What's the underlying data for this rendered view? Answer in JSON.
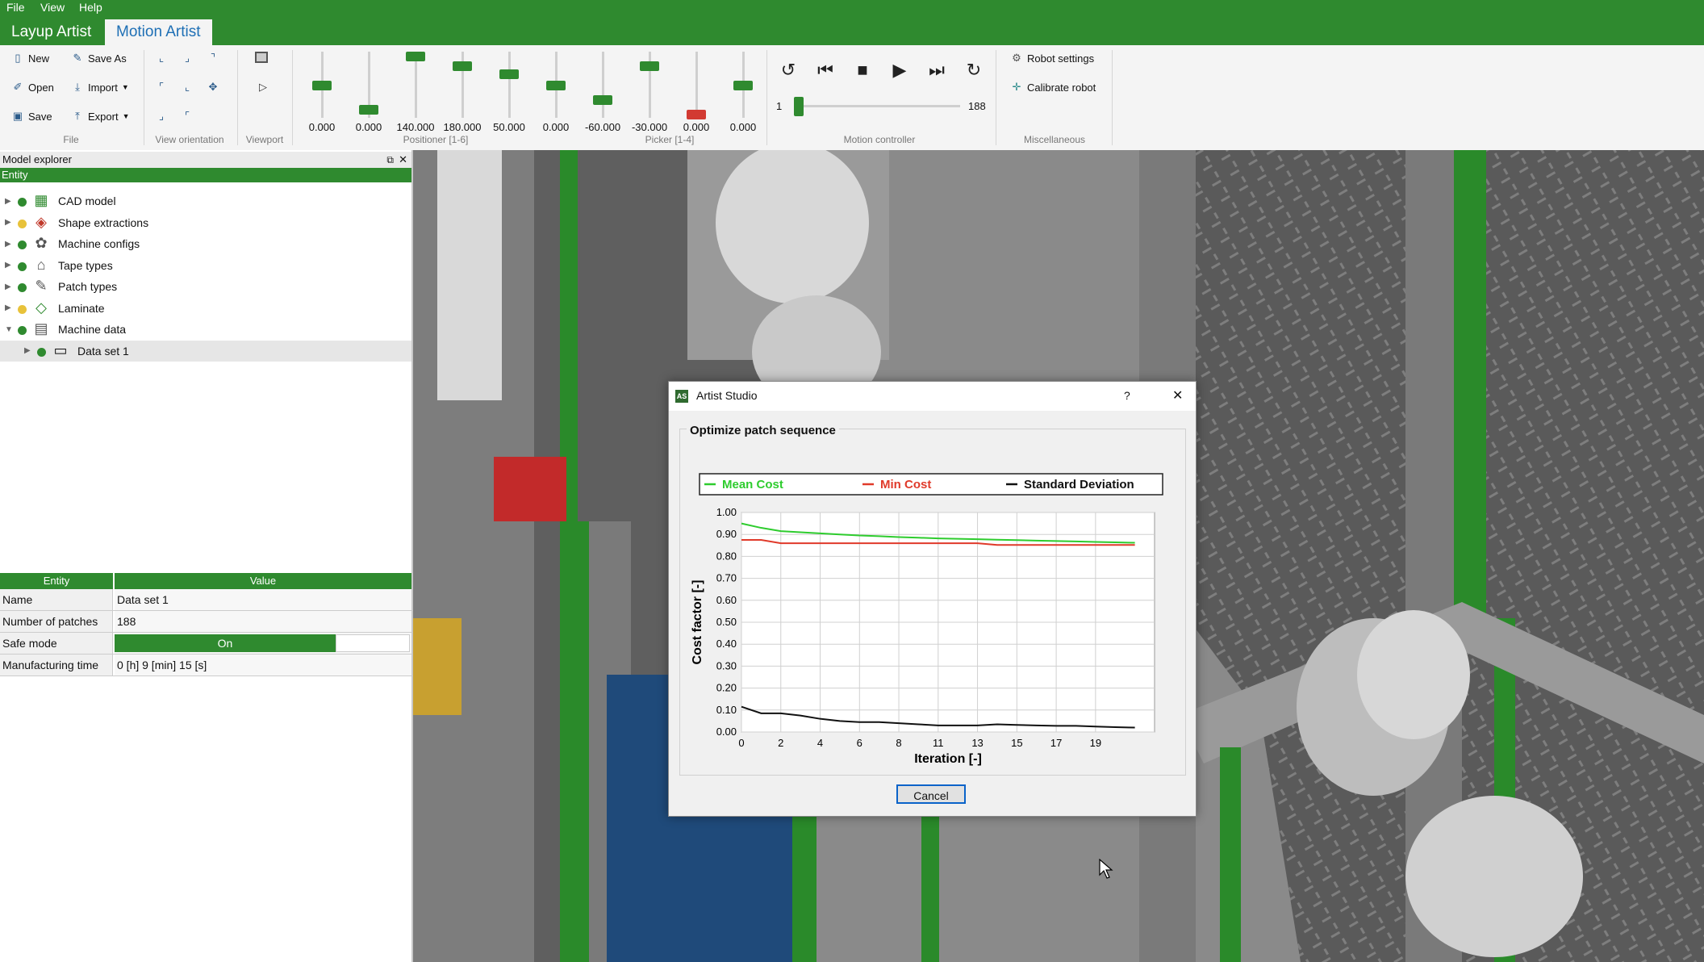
{
  "menu": [
    "File",
    "View",
    "Help"
  ],
  "app_tabs": [
    {
      "label": "Layup Artist"
    },
    {
      "label": "Motion Artist"
    }
  ],
  "ribbon": {
    "file": {
      "new": "New",
      "save_as": "Save As",
      "open": "Open",
      "import": "Import",
      "save": "Save",
      "export": "Export",
      "group_label": "File"
    },
    "view_orientation_label": "View orientation",
    "viewport_label": "Viewport",
    "positioner": {
      "label": "Positioner [1-6]",
      "values": [
        "0.000",
        "0.000",
        "140.000",
        "180.000",
        "50.000",
        "0.000"
      ]
    },
    "picker": {
      "label": "Picker [1-4]",
      "values": [
        "-60.000",
        "-30.000",
        "0.000",
        "0.000"
      ]
    },
    "motion_controller": {
      "label": "Motion controller",
      "min": "1",
      "max": "188",
      "position_fraction": 0.0
    },
    "misc": {
      "label": "Miscellaneous",
      "robot_settings": "Robot settings",
      "calibrate_robot": "Calibrate robot"
    }
  },
  "explorer": {
    "title": "Model explorer",
    "column": "Entity",
    "items": [
      {
        "label": "CAD model",
        "status": "ok"
      },
      {
        "label": "Shape extractions",
        "status": "warn"
      },
      {
        "label": "Machine configs",
        "status": "ok"
      },
      {
        "label": "Tape types",
        "status": "ok"
      },
      {
        "label": "Patch types",
        "status": "ok"
      },
      {
        "label": "Laminate",
        "status": "warn"
      },
      {
        "label": "Machine data",
        "status": "ok",
        "expanded": true
      }
    ],
    "child": {
      "label": "Data set 1",
      "status": "ok"
    }
  },
  "properties": {
    "headers": [
      "Entity",
      "Value"
    ],
    "rows": [
      {
        "name": "Name",
        "value": "Data set 1"
      },
      {
        "name": "Number of patches",
        "value": "188"
      },
      {
        "name": "Safe mode",
        "value": "On"
      },
      {
        "name": "Manufacturing time",
        "value": "0 [h] 9 [min] 15 [s]"
      }
    ]
  },
  "dialog": {
    "title": "Artist Studio",
    "help": "?",
    "close": "✕",
    "group_title": "Optimize patch sequence",
    "cancel": "Cancel"
  },
  "colors": {
    "brand_green": "#2f8a2f",
    "mean": "#2ecc2e",
    "min": "#e03a2a",
    "std": "#111111"
  },
  "chart_data": {
    "type": "line",
    "xlabel": "Iteration [-]",
    "ylabel": "Cost factor [-]",
    "xlim": [
      0,
      21
    ],
    "ylim": [
      0,
      1
    ],
    "x_ticks": [
      "0",
      "2",
      "4",
      "6",
      "8",
      "11",
      "13",
      "15",
      "17",
      "19"
    ],
    "y_ticks": [
      "0.00",
      "0.10",
      "0.20",
      "0.30",
      "0.40",
      "0.50",
      "0.60",
      "0.70",
      "0.80",
      "0.90",
      "1.00"
    ],
    "legend_position": "top",
    "x": [
      0,
      1,
      2,
      3,
      4,
      5,
      6,
      7,
      8,
      9,
      10,
      11,
      12,
      13,
      14,
      15,
      16,
      17,
      18,
      19,
      20
    ],
    "series": [
      {
        "name": "Mean Cost",
        "values": [
          0.95,
          0.93,
          0.915,
          0.91,
          0.905,
          0.9,
          0.895,
          0.892,
          0.888,
          0.885,
          0.882,
          0.88,
          0.878,
          0.876,
          0.874,
          0.872,
          0.87,
          0.868,
          0.866,
          0.864,
          0.862
        ]
      },
      {
        "name": "Min Cost",
        "values": [
          0.875,
          0.875,
          0.86,
          0.86,
          0.86,
          0.86,
          0.86,
          0.86,
          0.86,
          0.86,
          0.86,
          0.86,
          0.86,
          0.852,
          0.852,
          0.852,
          0.852,
          0.852,
          0.852,
          0.852,
          0.852
        ]
      },
      {
        "name": "Standard Deviation",
        "values": [
          0.115,
          0.085,
          0.085,
          0.075,
          0.06,
          0.05,
          0.045,
          0.045,
          0.04,
          0.035,
          0.03,
          0.03,
          0.03,
          0.035,
          0.032,
          0.03,
          0.028,
          0.028,
          0.025,
          0.022,
          0.02
        ]
      }
    ]
  }
}
